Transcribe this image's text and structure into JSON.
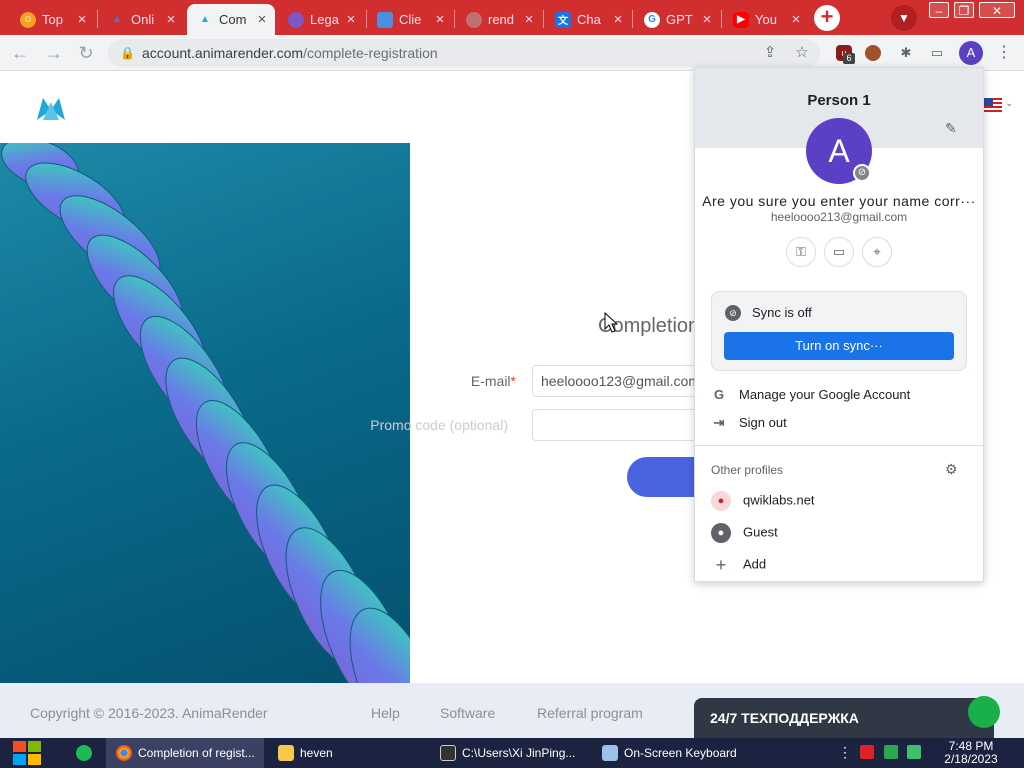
{
  "tabs": [
    {
      "title": "Top",
      "icon": "fire-icon",
      "color": "#f4a21b"
    },
    {
      "title": "Onli",
      "icon": "animarender-icon",
      "color": "#3b7fe0"
    },
    {
      "title": "Com",
      "icon": "animarender-icon",
      "color": "#1da8d8",
      "active": true
    },
    {
      "title": "Lega",
      "icon": "circle-icon",
      "color": "#7e57c2"
    },
    {
      "title": "Clie",
      "icon": "square-icon",
      "color": "#4a90e2"
    },
    {
      "title": "rend",
      "icon": "loading-icon",
      "color": "#c0c0c0"
    },
    {
      "title": "Cha",
      "icon": "translate-icon",
      "color": "#1a73e8"
    },
    {
      "title": "GPT",
      "icon": "google-icon",
      "color": "#ffffff"
    },
    {
      "title": "You",
      "icon": "youtube-icon",
      "color": "#ff0000"
    }
  ],
  "url": {
    "domain": "account.animarender.com",
    "path": "/complete-registration"
  },
  "extension_badge": "6",
  "profile_initial": "A",
  "page": {
    "title": "Completion",
    "email_label": "E-mail",
    "email_value": "heeloooo123@gmail.com",
    "promo_label": "Promo code (optional)"
  },
  "footer": {
    "copyright": "Copyright © 2016-2023. AnimaRender",
    "help": "Help",
    "software": "Software",
    "referral": "Referral program",
    "support": "24/7 ТЕХПОДДЕРЖКА"
  },
  "profile_menu": {
    "name": "Person 1",
    "avatar_letter": "A",
    "full_name": "Are you sure you enter your name corr···",
    "email": "heeloooo213@gmail.com",
    "quick_actions": [
      "key-icon",
      "card-icon",
      "location-icon"
    ],
    "sync_status": "Sync is off",
    "sync_button": "Turn on sync···",
    "manage_account": "Manage your Google Account",
    "sign_out": "Sign out",
    "other_profiles_label": "Other profiles",
    "profiles": [
      "qwiklabs.net",
      "Guest"
    ],
    "add": "Add"
  },
  "taskbar": {
    "items": [
      "Completion of regist...",
      "heven",
      "C:\\Users\\Xi JinPing...",
      "On-Screen Keyboard"
    ],
    "time": "7:48 PM",
    "date": "2/18/2023"
  }
}
